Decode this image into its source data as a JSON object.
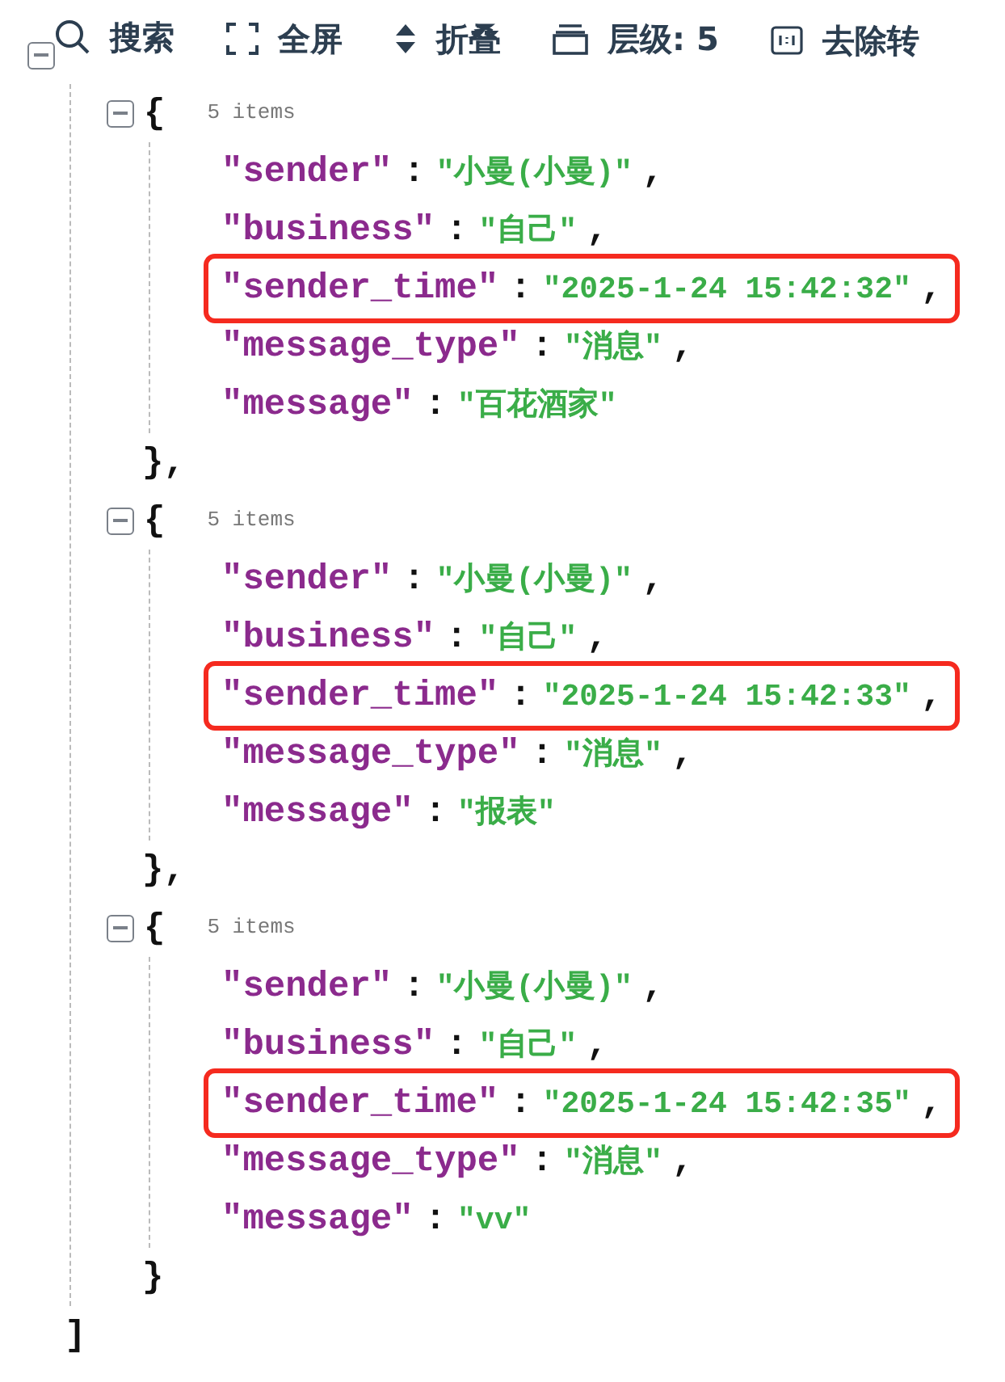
{
  "toolbar": [
    {
      "kind": "search",
      "label": "搜索"
    },
    {
      "kind": "fullscreen",
      "label": "全屏"
    },
    {
      "kind": "fold",
      "label": "折叠"
    },
    {
      "kind": "level",
      "label": "层级: 5"
    },
    {
      "kind": "strip",
      "label": "去除转"
    }
  ],
  "root": {
    "expanded": true,
    "close": "]",
    "items": [
      {
        "open": "{",
        "expanded": true,
        "count": "5 items",
        "close": "},",
        "fields": [
          {
            "key": "\"sender\"",
            "colon": ":",
            "value": "\"小曼(小曼)\"",
            "comma": ",",
            "highlighted": false
          },
          {
            "key": "\"business\"",
            "colon": ":",
            "value": "\"自己\"",
            "comma": ",",
            "highlighted": false
          },
          {
            "key": "\"sender_time\"",
            "colon": ":",
            "value": "\"2025-1-24 15:42:32\"",
            "comma": ",",
            "highlighted": true
          },
          {
            "key": "\"message_type\"",
            "colon": ":",
            "value": "\"消息\"",
            "comma": ",",
            "highlighted": false
          },
          {
            "key": "\"message\"",
            "colon": ":",
            "value": "\"百花酒家\"",
            "highlighted": false
          }
        ]
      },
      {
        "open": "{",
        "expanded": true,
        "count": "5 items",
        "close": "},",
        "fields": [
          {
            "key": "\"sender\"",
            "colon": ":",
            "value": "\"小曼(小曼)\"",
            "comma": ",",
            "highlighted": false
          },
          {
            "key": "\"business\"",
            "colon": ":",
            "value": "\"自己\"",
            "comma": ",",
            "highlighted": false
          },
          {
            "key": "\"sender_time\"",
            "colon": ":",
            "value": "\"2025-1-24 15:42:33\"",
            "comma": ",",
            "highlighted": true
          },
          {
            "key": "\"message_type\"",
            "colon": ":",
            "value": "\"消息\"",
            "comma": ",",
            "highlighted": false
          },
          {
            "key": "\"message\"",
            "colon": ":",
            "value": "\"报表\"",
            "highlighted": false
          }
        ]
      },
      {
        "open": "{",
        "expanded": true,
        "count": "5 items",
        "close": "}",
        "fields": [
          {
            "key": "\"sender\"",
            "colon": ":",
            "value": "\"小曼(小曼)\"",
            "comma": ",",
            "highlighted": false
          },
          {
            "key": "\"business\"",
            "colon": ":",
            "value": "\"自己\"",
            "comma": ",",
            "highlighted": false
          },
          {
            "key": "\"sender_time\"",
            "colon": ":",
            "value": "\"2025-1-24 15:42:35\"",
            "comma": ",",
            "highlighted": true
          },
          {
            "key": "\"message_type\"",
            "colon": ":",
            "value": "\"消息\"",
            "comma": ",",
            "highlighted": false
          },
          {
            "key": "\"message\"",
            "colon": ":",
            "value": "\"vv\"",
            "highlighted": false
          }
        ]
      }
    ]
  }
}
